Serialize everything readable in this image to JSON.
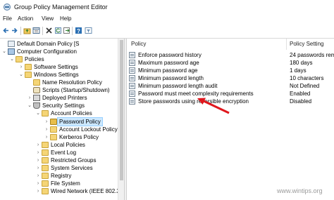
{
  "window": {
    "title": "Group Policy Management Editor",
    "app_icon": "gpo-editor-icon"
  },
  "menu": [
    "File",
    "Action",
    "View",
    "Help"
  ],
  "toolbar": {
    "buttons": [
      "back-icon",
      "forward-icon",
      "folder-up-icon",
      "properties-icon",
      "delete-icon",
      "refresh-icon",
      "export-icon",
      "help-icon",
      "filter-icon"
    ]
  },
  "tree": [
    {
      "label": "Default Domain Policy [S",
      "level": 0,
      "chev": "",
      "icon": "policy-doc-icon"
    },
    {
      "label": "Computer Configuration",
      "level": 0,
      "chev": "⌄",
      "icon": "computer-icon"
    },
    {
      "label": "Policies",
      "level": 1,
      "chev": "⌄",
      "icon": "folder-icon"
    },
    {
      "label": "Software Settings",
      "level": 2,
      "chev": "›",
      "icon": "folder-icon"
    },
    {
      "label": "Windows Settings",
      "level": 2,
      "chev": "⌄",
      "icon": "folder-icon"
    },
    {
      "label": "Name Resolution Policy",
      "level": 3,
      "chev": "",
      "icon": "folder-icon"
    },
    {
      "label": "Scripts (Startup/Shutdown)",
      "level": 3,
      "chev": "",
      "icon": "scroll-icon"
    },
    {
      "label": "Deployed Printers",
      "level": 3,
      "chev": "›",
      "icon": "printer-icon"
    },
    {
      "label": "Security Settings",
      "level": 3,
      "chev": "⌄",
      "icon": "shield-icon"
    },
    {
      "label": "Account Policies",
      "level": 4,
      "chev": "⌄",
      "icon": "folder-icon"
    },
    {
      "label": "Password Policy",
      "level": 5,
      "chev": "›",
      "icon": "folder-icon",
      "selected": true
    },
    {
      "label": "Account Lockout Policy",
      "level": 5,
      "chev": "›",
      "icon": "folder-icon"
    },
    {
      "label": "Kerberos Policy",
      "level": 5,
      "chev": "›",
      "icon": "folder-icon"
    },
    {
      "label": "Local Policies",
      "level": 4,
      "chev": "›",
      "icon": "folder-icon"
    },
    {
      "label": "Event Log",
      "level": 4,
      "chev": "›",
      "icon": "folder-icon"
    },
    {
      "label": "Restricted Groups",
      "level": 4,
      "chev": "›",
      "icon": "folder-icon"
    },
    {
      "label": "System Services",
      "level": 4,
      "chev": "›",
      "icon": "folder-icon"
    },
    {
      "label": "Registry",
      "level": 4,
      "chev": "›",
      "icon": "folder-icon"
    },
    {
      "label": "File System",
      "level": 4,
      "chev": "›",
      "icon": "folder-icon"
    },
    {
      "label": "Wired Network (IEEE 802.3",
      "level": 4,
      "chev": "›",
      "icon": "folder-icon"
    }
  ],
  "list": {
    "columns": [
      "Policy",
      "Policy Setting"
    ],
    "rows": [
      {
        "name": "Enforce password history",
        "setting": "24 passwords rem"
      },
      {
        "name": "Maximum password age",
        "setting": "180 days"
      },
      {
        "name": "Minimum password age",
        "setting": "1 days"
      },
      {
        "name": "Minimum password length",
        "setting": "10 characters"
      },
      {
        "name": "Minimum password length audit",
        "setting": "Not Defined"
      },
      {
        "name": "Password must meet complexity requirements",
        "setting": "Enabled"
      },
      {
        "name": "Store passwords using reversible encryption",
        "setting": "Disabled"
      }
    ]
  },
  "annotation": {
    "arrow_color": "#e0171d"
  },
  "watermark": "www.wintips.org"
}
